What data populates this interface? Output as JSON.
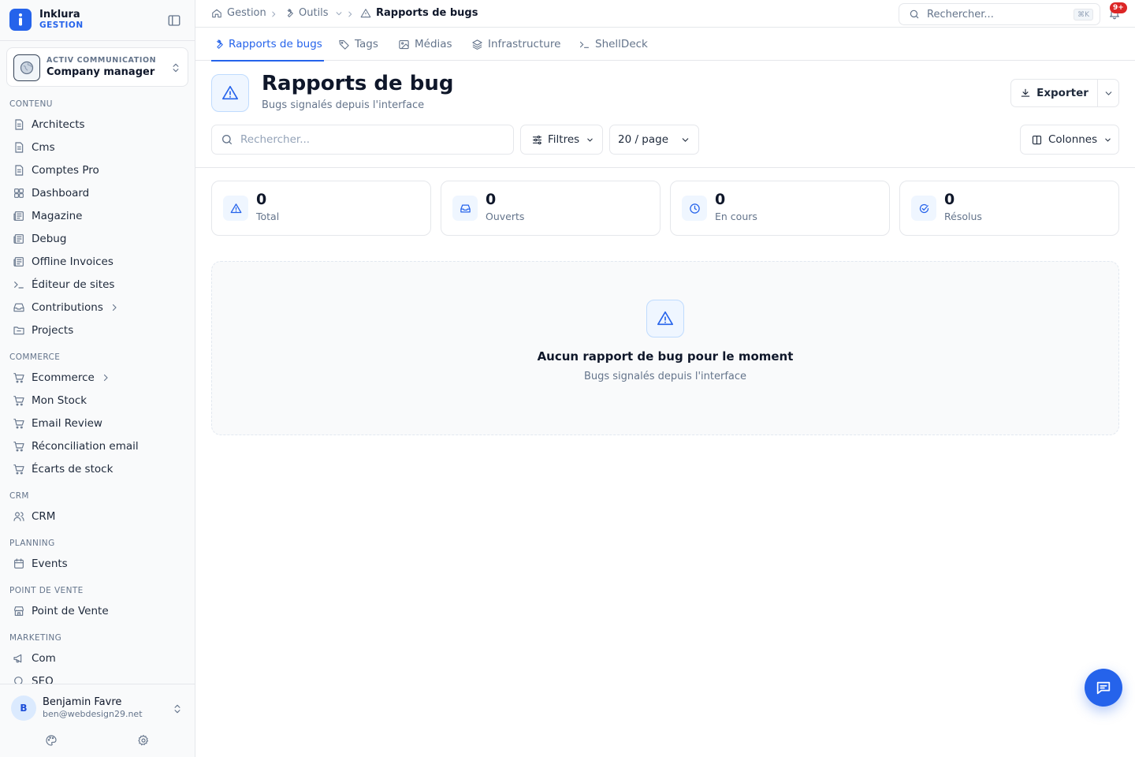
{
  "brand": {
    "name": "Inklura",
    "subtitle": "GESTION"
  },
  "company": {
    "org": "ACTIV COMMUNICATION",
    "role": "Company manager"
  },
  "sidebar": {
    "sections": {
      "contenu": "CONTENU",
      "commerce": "COMMERCE",
      "crm": "CRM",
      "planning": "PLANNING",
      "pos": "POINT DE VENTE",
      "marketing": "MARKETING"
    },
    "items": [
      {
        "label": "Architects",
        "icon": "document-icon"
      },
      {
        "label": "Cms",
        "icon": "document-icon"
      },
      {
        "label": "Comptes Pro",
        "icon": "document-icon"
      },
      {
        "label": "Dashboard",
        "icon": "grid-icon"
      },
      {
        "label": "Magazine",
        "icon": "newspaper-icon"
      },
      {
        "label": "Debug",
        "icon": "newspaper-icon"
      },
      {
        "label": "Offline Invoices",
        "icon": "newspaper-icon"
      },
      {
        "label": "Éditeur de sites",
        "icon": "terminal-icon"
      },
      {
        "label": "Contributions",
        "icon": "inbox-icon"
      },
      {
        "label": "Projects",
        "icon": "folder-icon"
      },
      {
        "label": "Ecommerce",
        "icon": "cart-icon"
      },
      {
        "label": "Mon Stock",
        "icon": "cart-icon"
      },
      {
        "label": "Email Review",
        "icon": "cart-icon"
      },
      {
        "label": "Réconciliation email",
        "icon": "cart-icon"
      },
      {
        "label": "Écarts de stock",
        "icon": "cart-icon"
      },
      {
        "label": "CRM",
        "icon": "users-icon"
      },
      {
        "label": "Events",
        "icon": "calendar-icon"
      },
      {
        "label": "Point de Vente",
        "icon": "store-icon"
      },
      {
        "label": "Com",
        "icon": "megaphone-icon"
      },
      {
        "label": "SEO",
        "icon": "search-icon"
      }
    ]
  },
  "user": {
    "initial": "B",
    "name": "Benjamin Favre",
    "email": "ben@webdesign29.net"
  },
  "breadcrumb": {
    "root": "Gestion",
    "middle": "Outils",
    "current": "Rapports de bugs"
  },
  "global_search": {
    "placeholder": "Rechercher...",
    "shortcut": "⌘K"
  },
  "notifications": {
    "badge": "9+"
  },
  "tabs": [
    {
      "label": "Rapports de bugs",
      "icon": "wrench-icon"
    },
    {
      "label": "Tags",
      "icon": "tag-icon"
    },
    {
      "label": "Médias",
      "icon": "image-icon"
    },
    {
      "label": "Infrastructure",
      "icon": "layers-icon"
    },
    {
      "label": "ShellDeck",
      "icon": "terminal-icon"
    }
  ],
  "page": {
    "title": "Rapports de bug",
    "subtitle": "Bugs signalés depuis l'interface"
  },
  "toolbar": {
    "search_placeholder": "Rechercher...",
    "filters_label": "Filtres",
    "page_size_label": "20 / page",
    "columns_label": "Colonnes",
    "export_label": "Exporter"
  },
  "stats": [
    {
      "value": "0",
      "label": "Total",
      "icon": "alert-triangle-icon"
    },
    {
      "value": "0",
      "label": "Ouverts",
      "icon": "inbox-icon"
    },
    {
      "value": "0",
      "label": "En cours",
      "icon": "clock-icon"
    },
    {
      "value": "0",
      "label": "Résolus",
      "icon": "check-circle-icon"
    }
  ],
  "empty_state": {
    "title": "Aucun rapport de bug pour le moment",
    "subtitle": "Bugs signalés depuis l'interface"
  },
  "colors": {
    "accent": "#2563eb",
    "badge": "#dc2626"
  }
}
